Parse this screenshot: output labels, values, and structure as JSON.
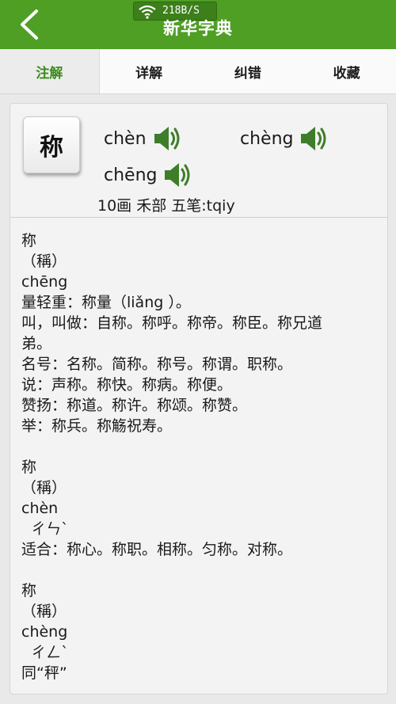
{
  "header": {
    "title": "新华字典",
    "network_speed": "218B/S"
  },
  "tabs": [
    {
      "label": "注解"
    },
    {
      "label": "详解"
    },
    {
      "label": "纠错"
    },
    {
      "label": "收藏"
    }
  ],
  "entry": {
    "character": "称",
    "pronunciations": [
      "chèn",
      "chèng",
      "chēng"
    ],
    "info": "10画  禾部  五笔:tqiy"
  },
  "definition": {
    "block1": {
      "l1": "称",
      "l2": "（稱）",
      "l3": "chēng",
      "l4": "量轻重：称量（liǎ​ng ）。",
      "l5": "叫，叫做：自称。称呼。称帝。称臣。称兄道",
      "l6": "弟。",
      "l7": "名号：名称。简称。称号。称谓。职称。",
      "l8": "说：声称。称快。称病。称便。",
      "l9": "赞扬：称道。称许。称颂。称赞。",
      "l10": "举：称兵。称觞祝寿。"
    },
    "block2": {
      "l1": "称",
      "l2": "（稱）",
      "l3": "chèn",
      "l4": "  ㄔㄣˋ",
      "l5": "适合：称心。称职。相称。匀称。对称。"
    },
    "block3": {
      "l1": "称",
      "l2": "（稱）",
      "l3": "chèng",
      "l4": "  ㄔㄥˋ",
      "l5": "同“秤”"
    }
  },
  "colors": {
    "brand_green": "#4e9f24",
    "active_tab_text": "#3b8a1c",
    "speaker_green": "#3e7d2a"
  }
}
